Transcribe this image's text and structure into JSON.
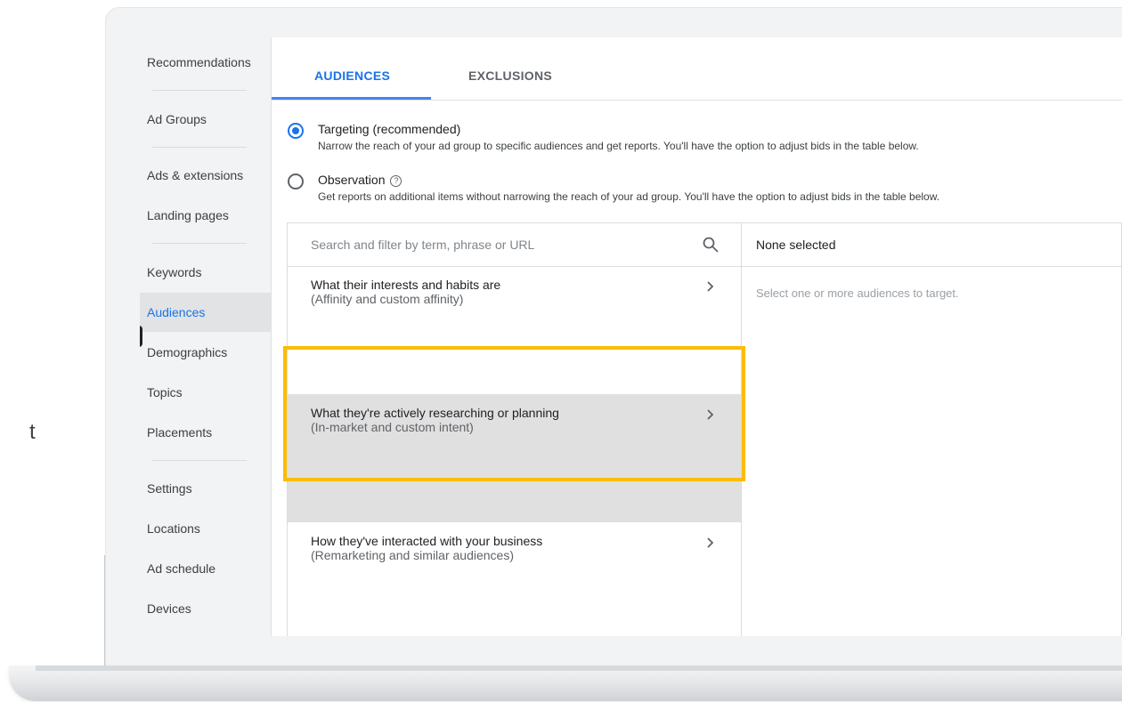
{
  "outside_char": "t",
  "nav": {
    "items": [
      {
        "label": "Recommendations"
      },
      {
        "label": "Ad Groups"
      },
      {
        "label": "Ads & extensions"
      },
      {
        "label": "Landing pages"
      },
      {
        "label": "Keywords"
      },
      {
        "label": "Audiences",
        "active": true
      },
      {
        "label": "Demographics"
      },
      {
        "label": "Topics"
      },
      {
        "label": "Placements"
      },
      {
        "label": "Settings"
      },
      {
        "label": "Locations"
      },
      {
        "label": "Ad schedule"
      },
      {
        "label": "Devices"
      }
    ]
  },
  "tabs": [
    {
      "label": "AUDIENCES",
      "active": true
    },
    {
      "label": "EXCLUSIONS",
      "active": false
    }
  ],
  "mode": {
    "targeting": {
      "label": "Targeting (recommended)",
      "description": "Narrow the reach of your ad group to specific audiences and get reports. You'll have the option to adjust bids in the table below.",
      "selected": true
    },
    "observation": {
      "label": "Observation",
      "description": "Get reports on additional items without narrowing the reach of your ad group. You'll have the option to adjust bids in the table below.",
      "selected": false
    }
  },
  "search": {
    "placeholder": "Search and filter by term, phrase or URL",
    "icon": "search-icon"
  },
  "categories": [
    {
      "title": "What their interests and habits are",
      "subtitle": "(Affinity and custom affinity)"
    },
    {
      "title": "What they're actively researching or planning",
      "subtitle": "(In-market and custom intent)",
      "highlighted": true
    },
    {
      "title": "How they've interacted with your business",
      "subtitle": "(Remarketing and similar audiences)"
    }
  ],
  "selection": {
    "header": "None selected",
    "empty_message": "Select one or more audiences to target."
  },
  "colors": {
    "accent": "#1a73e8",
    "highlight_border": "#fbbc04",
    "nav_background": "#f1f3f4"
  }
}
